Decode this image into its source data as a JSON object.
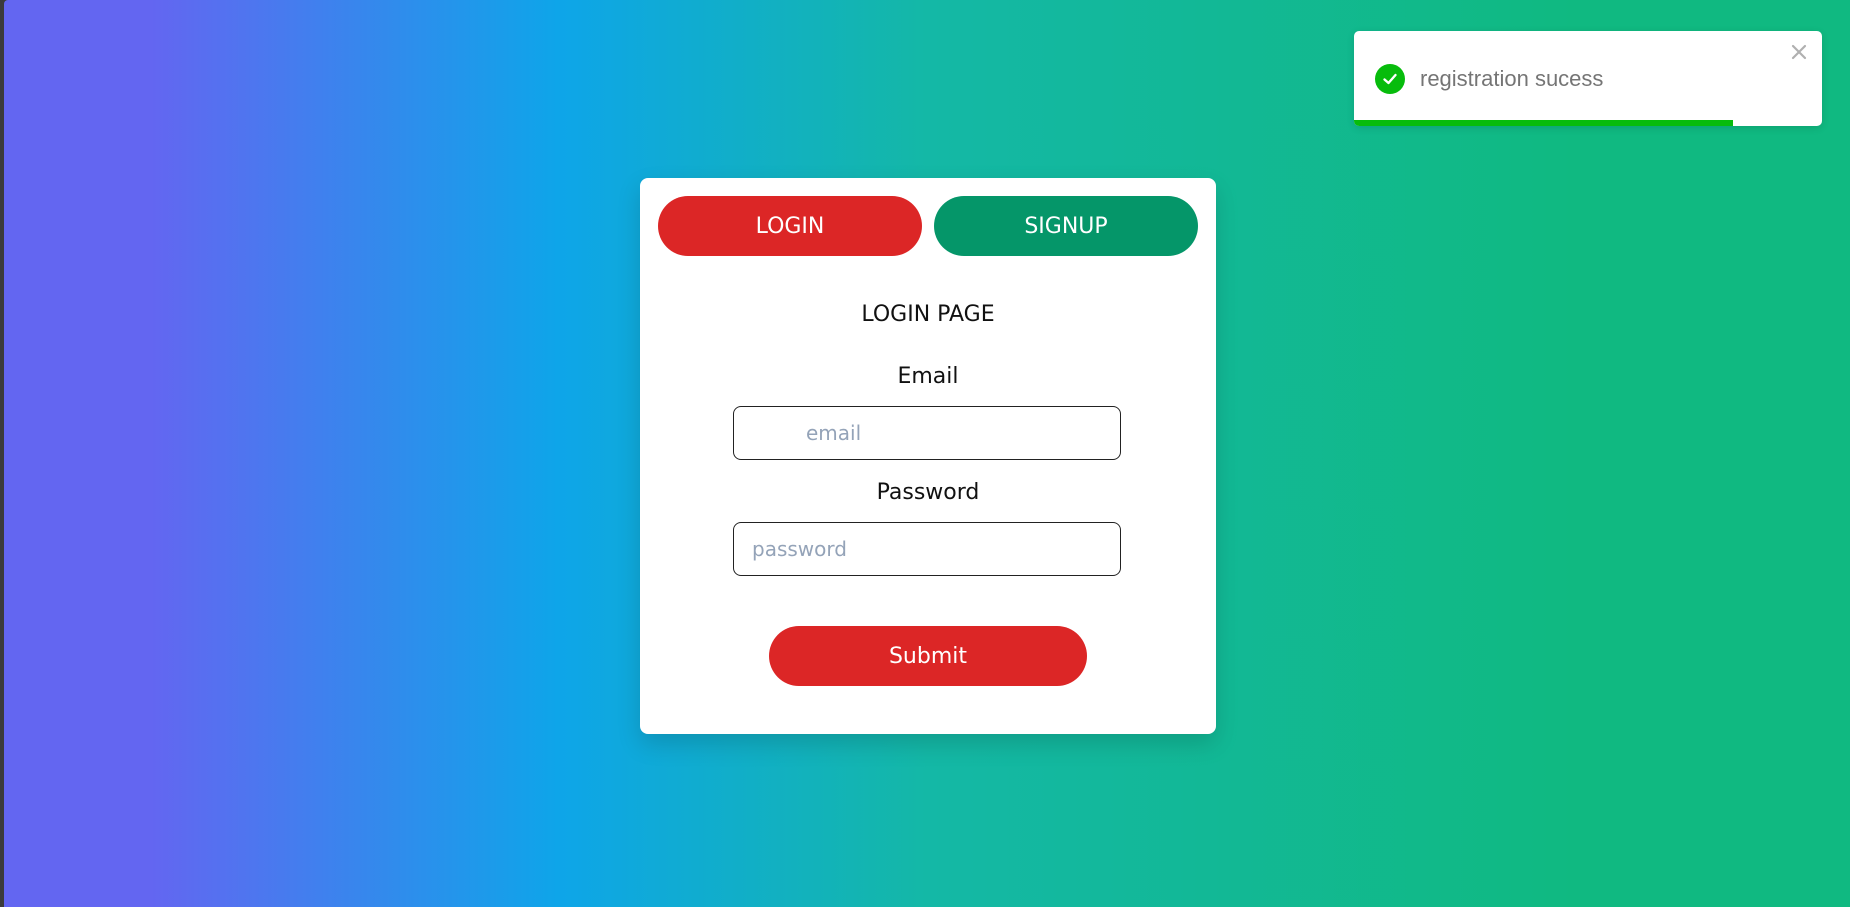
{
  "tabs": {
    "login_label": "LOGIN",
    "signup_label": "SIGNUP"
  },
  "form": {
    "title": "LOGIN PAGE",
    "email_label": "Email",
    "email_placeholder": "email",
    "password_label": "Password",
    "password_placeholder": "password",
    "submit_label": "Submit"
  },
  "toast": {
    "message": "registration sucess",
    "progress": 0.81,
    "icon": "check-circle-icon",
    "close_icon": "close-icon"
  },
  "colors": {
    "login_red": "#dc2626",
    "signup_green": "#059669",
    "toast_success": "#07bc0c"
  }
}
